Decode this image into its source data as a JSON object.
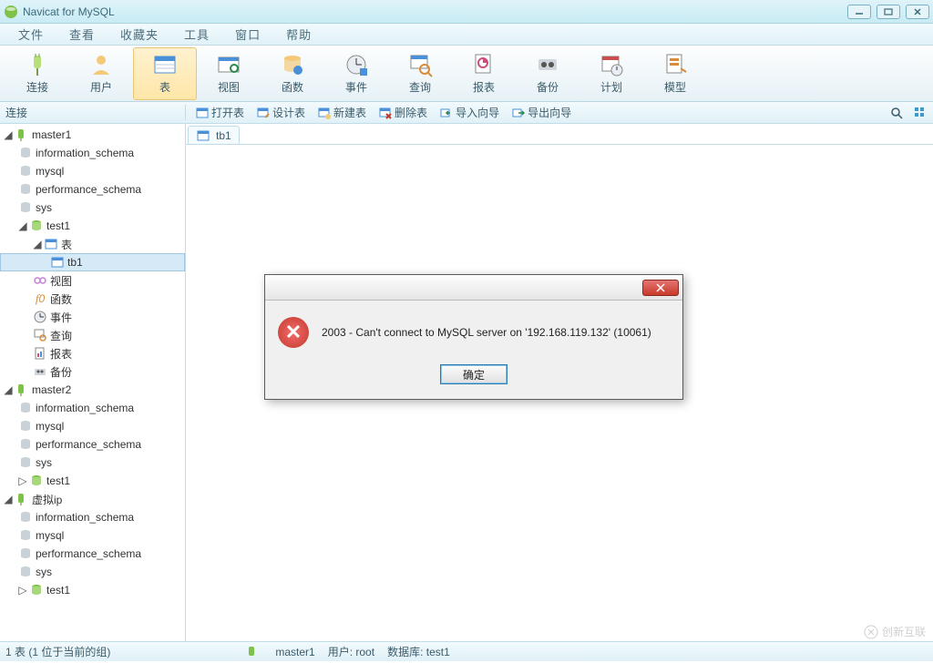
{
  "window": {
    "title": "Navicat for MySQL"
  },
  "menu": {
    "items": [
      "文件",
      "查看",
      "收藏夹",
      "工具",
      "窗口",
      "帮助"
    ]
  },
  "toolbar": {
    "items": [
      {
        "label": "连接",
        "id": "connect"
      },
      {
        "label": "用户",
        "id": "user"
      },
      {
        "label": "表",
        "id": "table",
        "active": true
      },
      {
        "label": "视图",
        "id": "view"
      },
      {
        "label": "函数",
        "id": "function"
      },
      {
        "label": "事件",
        "id": "event"
      },
      {
        "label": "查询",
        "id": "query"
      },
      {
        "label": "报表",
        "id": "report"
      },
      {
        "label": "备份",
        "id": "backup"
      },
      {
        "label": "计划",
        "id": "schedule"
      },
      {
        "label": "模型",
        "id": "model"
      }
    ]
  },
  "subbar": {
    "left_title": "连接",
    "buttons": [
      {
        "label": "打开表",
        "id": "open-table"
      },
      {
        "label": "设计表",
        "id": "design-table"
      },
      {
        "label": "新建表",
        "id": "new-table"
      },
      {
        "label": "删除表",
        "id": "delete-table"
      },
      {
        "label": "导入向导",
        "id": "import-wizard"
      },
      {
        "label": "导出向导",
        "id": "export-wizard"
      }
    ]
  },
  "tabs": {
    "active": "tb1"
  },
  "tree": {
    "connections": [
      {
        "name": "master1",
        "expanded": true,
        "dbs": [
          {
            "name": "information_schema"
          },
          {
            "name": "mysql"
          },
          {
            "name": "performance_schema"
          },
          {
            "name": "sys"
          },
          {
            "name": "test1",
            "open": true,
            "expanded": true,
            "children": [
              {
                "kind": "tables",
                "label": "表",
                "expanded": true,
                "items": [
                  {
                    "name": "tb1",
                    "selected": true
                  }
                ]
              },
              {
                "kind": "views",
                "label": "视图"
              },
              {
                "kind": "functions",
                "label": "函数"
              },
              {
                "kind": "events",
                "label": "事件"
              },
              {
                "kind": "queries",
                "label": "查询"
              },
              {
                "kind": "reports",
                "label": "报表"
              },
              {
                "kind": "backups",
                "label": "备份"
              }
            ]
          }
        ]
      },
      {
        "name": "master2",
        "expanded": true,
        "dbs": [
          {
            "name": "information_schema"
          },
          {
            "name": "mysql"
          },
          {
            "name": "performance_schema"
          },
          {
            "name": "sys"
          },
          {
            "name": "test1",
            "closed": true
          }
        ]
      },
      {
        "name": "虚拟ip",
        "expanded": true,
        "dbs": [
          {
            "name": "information_schema"
          },
          {
            "name": "mysql"
          },
          {
            "name": "performance_schema"
          },
          {
            "name": "sys"
          },
          {
            "name": "test1",
            "closed": true
          }
        ]
      }
    ]
  },
  "dialog": {
    "message": "2003 - Can't connect to MySQL server on '192.168.119.132' (10061)",
    "ok": "确定"
  },
  "status": {
    "left": "1 表 (1 位于当前的组)",
    "conn": "master1",
    "user_label": "用户: root",
    "db_label": "数据库: test1"
  },
  "watermark": "创新互联"
}
